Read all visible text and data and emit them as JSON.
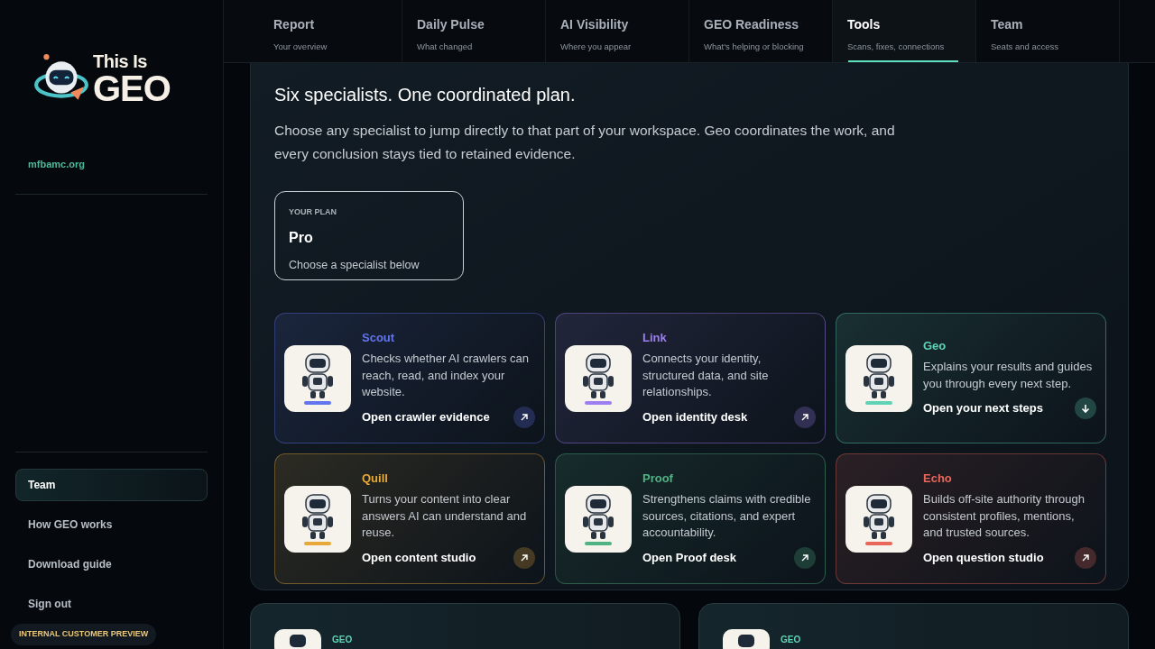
{
  "brand": {
    "line1": "This Is",
    "line2": "GEO",
    "domain": "mfbamc.org"
  },
  "sidebar": {
    "items": [
      {
        "label": "Team",
        "selected": true
      },
      {
        "label": "How GEO works",
        "selected": false
      },
      {
        "label": "Download guide",
        "selected": false
      },
      {
        "label": "Sign out",
        "selected": false
      }
    ]
  },
  "badge": "INTERNAL CUSTOMER PREVIEW",
  "tabs": [
    {
      "label": "Report",
      "sub": "Your overview",
      "selected": false
    },
    {
      "label": "Daily Pulse",
      "sub": "What changed",
      "selected": false
    },
    {
      "label": "AI Visibility",
      "sub": "Where you appear",
      "selected": false
    },
    {
      "label": "GEO Readiness",
      "sub": "What's helping or blocking",
      "selected": false
    },
    {
      "label": "Tools",
      "sub": "Scans, fixes, connections",
      "selected": true
    },
    {
      "label": "Team",
      "sub": "Seats and access",
      "selected": false
    }
  ],
  "team": {
    "heading": "Six specialists. One coordinated plan.",
    "intro": "Choose any specialist to jump directly to that part of your workspace. Geo coordinates the work, and every conclusion stays tied to retained evidence.",
    "plan": {
      "label": "YOUR PLAN",
      "name": "Pro",
      "hint": "Choose a specialist below"
    },
    "specialists": [
      {
        "name": "Scout",
        "color": "#6274ee",
        "description": "Checks whether AI crawlers can reach, read, and index your website.",
        "action": "Open crawler evidence",
        "kind": "external"
      },
      {
        "name": "Link",
        "color": "#9d7ff2",
        "description": "Connects your identity, structured data, and site relationships.",
        "action": "Open identity desk",
        "kind": "external"
      },
      {
        "name": "Geo",
        "color": "#5fd3b5",
        "description": "Explains your results and guides you through every next step.",
        "action": "Open your next steps",
        "kind": "down"
      },
      {
        "name": "Quill",
        "color": "#e8a93a",
        "description": "Turns your content into clear answers AI can understand and reuse.",
        "action": "Open content studio",
        "kind": "external"
      },
      {
        "name": "Proof",
        "color": "#4fb383",
        "description": "Strengthens claims with credible sources, citations, and expert accountability.",
        "action": "Open Proof desk",
        "kind": "external"
      },
      {
        "name": "Echo",
        "color": "#e8665a",
        "description": "Builds off-site authority through consistent profiles, mentions, and trusted sources.",
        "action": "Open question studio",
        "kind": "external"
      }
    ]
  },
  "lower_cards": [
    {
      "label": "GEO"
    },
    {
      "label": "GEO"
    }
  ]
}
